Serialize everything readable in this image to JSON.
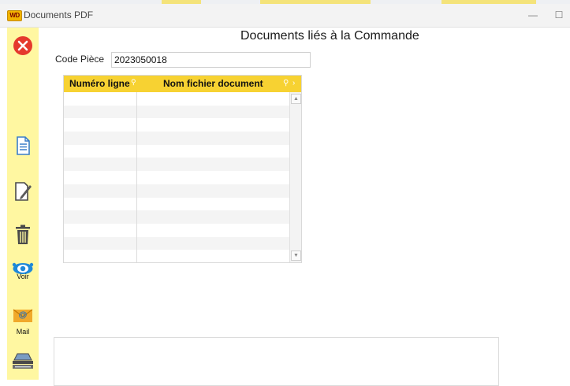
{
  "window": {
    "logo_text": "WD",
    "title": "Documents PDF",
    "minimize_glyph": "—",
    "maximize_glyph": "☐"
  },
  "sidebar": {
    "items": [
      {
        "icon": "close-icon",
        "label": ""
      },
      {
        "icon": "new-document-icon",
        "label": ""
      },
      {
        "icon": "edit-document-icon",
        "label": ""
      },
      {
        "icon": "trash-icon",
        "label": ""
      },
      {
        "icon": "view-eye-icon",
        "label": "Voir"
      },
      {
        "icon": "mail-icon",
        "label": "Mail"
      },
      {
        "icon": "scanner-icon",
        "label": ""
      }
    ]
  },
  "main": {
    "title": "Documents liés à la Commande",
    "code_piece_label": "Code Pièce",
    "code_piece_value": "2023050018"
  },
  "table": {
    "columns": [
      "Numéro ligne",
      "Nom fichier document"
    ],
    "rows": []
  },
  "colors": {
    "sidebar_bg": "#fff7a1",
    "table_header_bg": "#f7d232",
    "close_red": "#e5392d",
    "icon_blue": "#1e88d8"
  }
}
